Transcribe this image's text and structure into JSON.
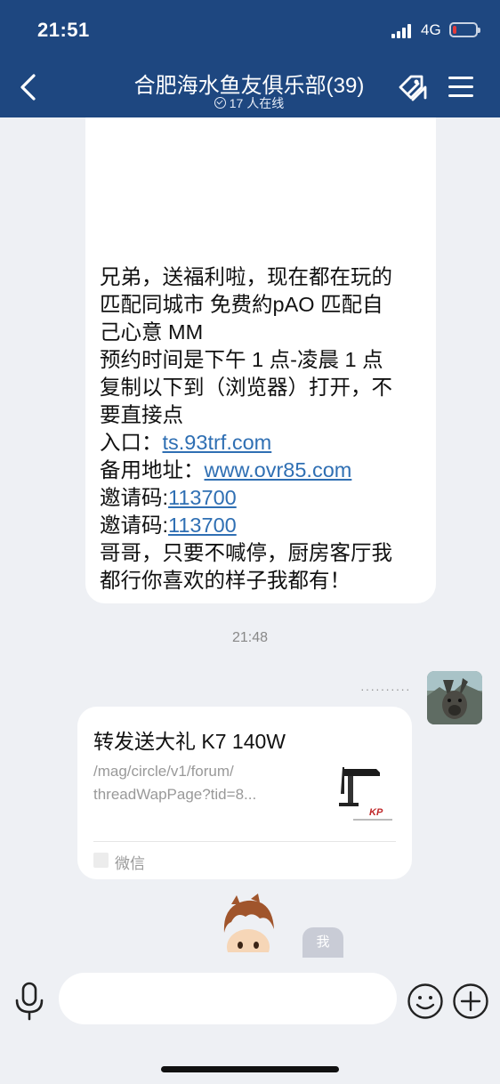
{
  "status_bar": {
    "time": "21:51",
    "network": "4G",
    "battery_level": 0.15,
    "battery_color": "#e23b3b",
    "signal_bars": 4
  },
  "header": {
    "title": "合肥海水鱼友俱乐部(39)",
    "online": "17 人在线",
    "background": "#1e4780"
  },
  "messages": {
    "incoming_lines": [
      "兄弟，送福利啦，现在都在玩的",
      "匹配同城市 免费約pAO 匹配自",
      "己心意 MM",
      "预约时间是下午 1 点-凌晨 1 点",
      "复制以下到（浏览器）打开，不",
      "要直接点"
    ],
    "entry_label": "入口：",
    "entry_link": "ts.93trf.com",
    "backup_label": "备用地址：",
    "backup_link": "www.ovr85.com",
    "invite_label_1": "邀请码:",
    "invite_code_1": "113700",
    "invite_label_2": "邀请码:",
    "invite_code_2": "113700",
    "tail_lines": [
      "哥哥，只要不喊停，厨房客厅我",
      "都行你喜欢的样子我都有！"
    ],
    "link_color": "#2f6fb3",
    "timestamp": "21:48",
    "pending_dots": "··········"
  },
  "share_card": {
    "title": "转发送大礼 K7 140W",
    "url_lines": [
      "/mag/circle/v1/forum/",
      "threadWapPage?tid=8..."
    ],
    "source": "微信",
    "thumb_brand": "KP"
  },
  "footer": {
    "me_badge": "我",
    "input_placeholder": ""
  }
}
